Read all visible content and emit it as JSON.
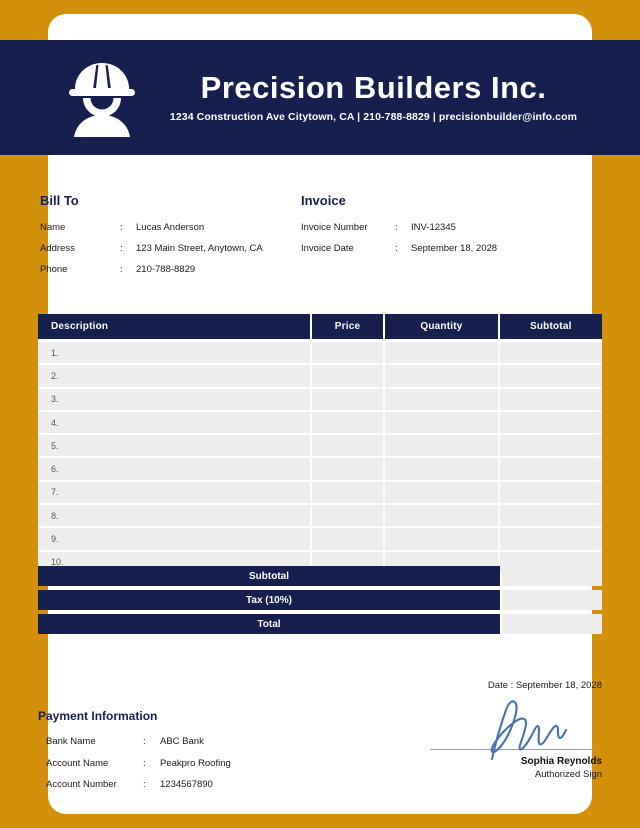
{
  "theme": {
    "accent_gold": "#d2900b",
    "navy": "#161f4e",
    "row_gray": "#eeeeee",
    "signature_blue": "#4a72ad"
  },
  "header": {
    "logo_icon": "construction-worker-icon",
    "company_name": "Precision Builders Inc.",
    "contact_line": "1234 Construction Ave Citytown, CA | 210-788-8829 | precisionbuilder@info.com"
  },
  "bill_to": {
    "title": "Bill To",
    "colon": ":",
    "rows": [
      {
        "label": "Name",
        "value": "Lucas Anderson"
      },
      {
        "label": "Address",
        "value": "123 Main Street, Anytown, CA"
      },
      {
        "label": "Phone",
        "value": "210-788-8829"
      }
    ]
  },
  "invoice": {
    "title": "Invoice",
    "colon": ":",
    "rows": [
      {
        "label": "Invoice Number",
        "value": "INV-12345"
      },
      {
        "label": "Invoice Date",
        "value": "September 18, 2028"
      }
    ]
  },
  "items_table": {
    "columns": [
      "Description",
      "Price",
      "Quantity",
      "Subtotal"
    ],
    "rows": [
      {
        "num": "1.",
        "description": "",
        "price": "",
        "quantity": "",
        "subtotal": ""
      },
      {
        "num": "2.",
        "description": "",
        "price": "",
        "quantity": "",
        "subtotal": ""
      },
      {
        "num": "3.",
        "description": "",
        "price": "",
        "quantity": "",
        "subtotal": ""
      },
      {
        "num": "4.",
        "description": "",
        "price": "",
        "quantity": "",
        "subtotal": ""
      },
      {
        "num": "5.",
        "description": "",
        "price": "",
        "quantity": "",
        "subtotal": ""
      },
      {
        "num": "6.",
        "description": "",
        "price": "",
        "quantity": "",
        "subtotal": ""
      },
      {
        "num": "7.",
        "description": "",
        "price": "",
        "quantity": "",
        "subtotal": ""
      },
      {
        "num": "8.",
        "description": "",
        "price": "",
        "quantity": "",
        "subtotal": ""
      },
      {
        "num": "9.",
        "description": "",
        "price": "",
        "quantity": "",
        "subtotal": ""
      },
      {
        "num": "10.",
        "description": "",
        "price": "",
        "quantity": "",
        "subtotal": ""
      }
    ]
  },
  "totals": [
    {
      "label": "Subtotal",
      "value": ""
    },
    {
      "label": "Tax (10%)",
      "value": ""
    },
    {
      "label": "Total",
      "value": ""
    }
  ],
  "payment_information": {
    "title": "Payment Information",
    "colon": ":",
    "rows": [
      {
        "label": "Bank Name",
        "value": "ABC Bank"
      },
      {
        "label": "Account Name",
        "value": "Peakpro Roofing"
      },
      {
        "label": "Account Number",
        "value": "1234567890"
      }
    ]
  },
  "signature": {
    "date_text": "Date : September 18, 2028",
    "signature_icon": "handwritten-signature-icon",
    "name": "Sophia Reynolds",
    "role": "Authorized Sign"
  }
}
